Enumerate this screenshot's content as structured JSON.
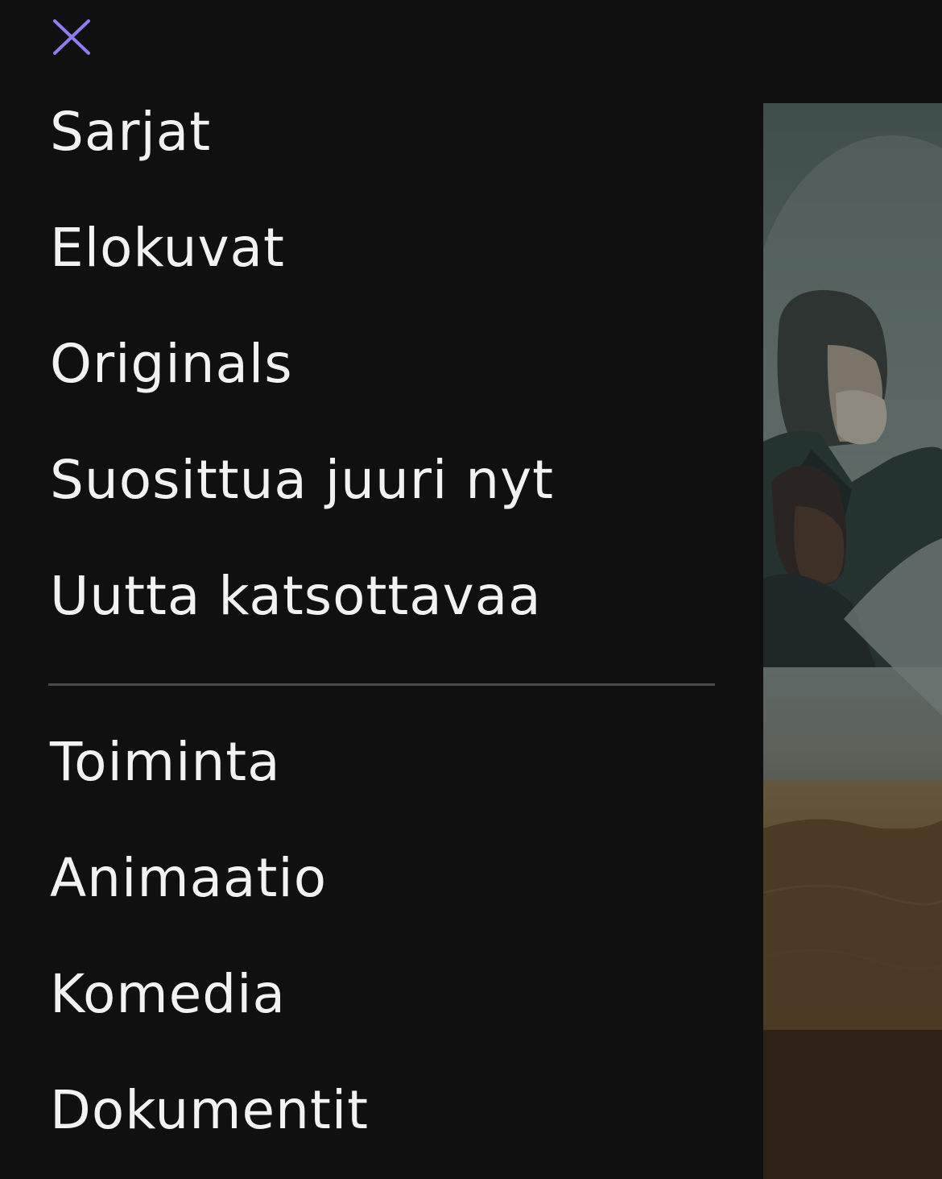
{
  "menu": {
    "close_icon": "close-icon",
    "close_color": "#8e7cf0",
    "primary_items": [
      {
        "label": "Sarjat"
      },
      {
        "label": "Elokuvat"
      },
      {
        "label": "Originals"
      },
      {
        "label": "Suosittua juuri nyt"
      },
      {
        "label": "Uutta katsottavaa"
      }
    ],
    "genre_items": [
      {
        "label": "Toiminta"
      },
      {
        "label": "Animaatio"
      },
      {
        "label": "Komedia"
      },
      {
        "label": "Dokumentit"
      }
    ]
  },
  "colors": {
    "background": "#101011",
    "text": "#f2f2f2",
    "accent": "#8e7cf0",
    "divider": "#4a4a4c"
  }
}
